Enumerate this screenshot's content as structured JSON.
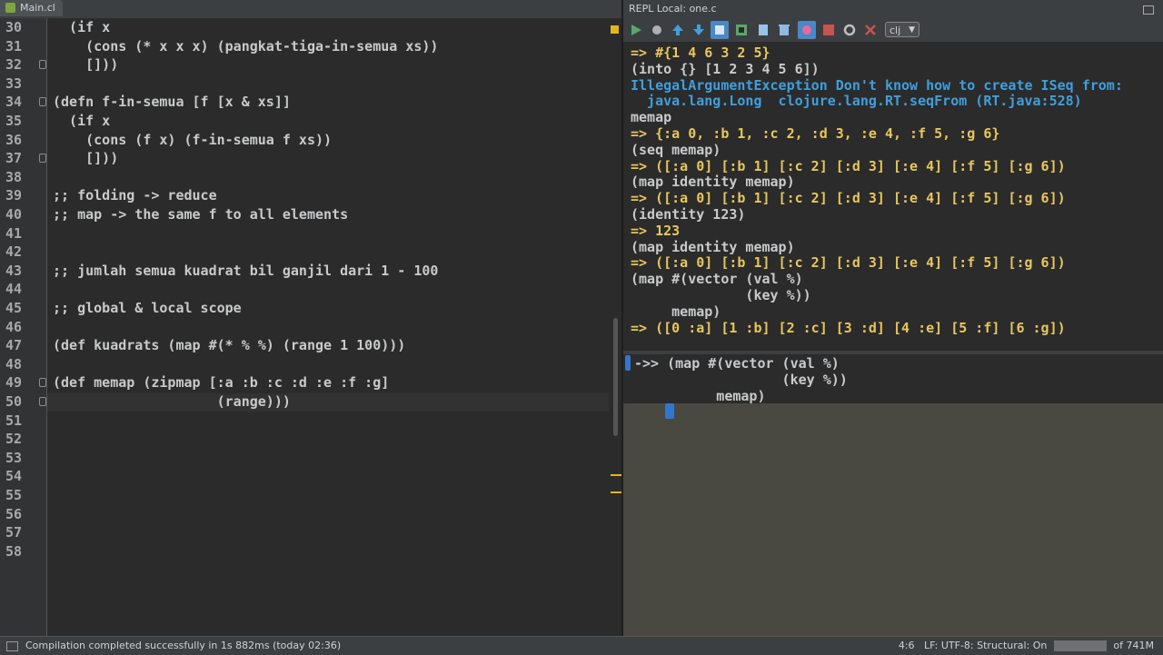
{
  "editor": {
    "tab_title": "Main.cl",
    "lines": [
      {
        "n": "30",
        "text": "  (if x"
      },
      {
        "n": "31",
        "text": "    (cons (* x x x) (pangkat-tiga-in-semua xs))"
      },
      {
        "n": "32",
        "text": "    []))"
      },
      {
        "n": "33",
        "text": ""
      },
      {
        "n": "34",
        "text": "(defn f-in-semua [f [x & xs]]"
      },
      {
        "n": "35",
        "text": "  (if x"
      },
      {
        "n": "36",
        "text": "    (cons (f x) (f-in-semua f xs))"
      },
      {
        "n": "37",
        "text": "    []))"
      },
      {
        "n": "38",
        "text": ""
      },
      {
        "n": "39",
        "text": ";; folding -> reduce"
      },
      {
        "n": "40",
        "text": ";; map -> the same f to all elements"
      },
      {
        "n": "41",
        "text": ""
      },
      {
        "n": "42",
        "text": ""
      },
      {
        "n": "43",
        "text": ";; jumlah semua kuadrat bil ganjil dari 1 - 100"
      },
      {
        "n": "44",
        "text": ""
      },
      {
        "n": "45",
        "text": ";; global & local scope"
      },
      {
        "n": "46",
        "text": ""
      },
      {
        "n": "47",
        "text": "(def kuadrats (map #(* % %) (range 1 100)))"
      },
      {
        "n": "48",
        "text": ""
      },
      {
        "n": "49",
        "text": "(def memap (zipmap [:a :b :c :d :e :f :g]"
      },
      {
        "n": "50",
        "text": "                    (range)))"
      },
      {
        "n": "51",
        "text": ""
      },
      {
        "n": "52",
        "text": ""
      },
      {
        "n": "53",
        "text": ""
      },
      {
        "n": "54",
        "text": ""
      },
      {
        "n": "55",
        "text": ""
      },
      {
        "n": "56",
        "text": ""
      },
      {
        "n": "57",
        "text": ""
      },
      {
        "n": "58",
        "text": ""
      }
    ]
  },
  "repl": {
    "title": "REPL Local: one.c",
    "lang_select": "clj",
    "toolbar_icons": [
      "run-icon",
      "stop-icon",
      "up-arrow-icon",
      "down-arrow-icon",
      "history-icon",
      "load-file-icon",
      "copy-icon",
      "clear-icon",
      "pin-icon",
      "close-red-icon",
      "refresh-icon",
      "close-x-icon"
    ],
    "output": [
      {
        "k": "res",
        "text": "=> #{1 4 6 3 2 5}"
      },
      {
        "k": "cmd",
        "text": "(into {} [1 2 3 4 5 6])"
      },
      {
        "k": "err",
        "text": "IllegalArgumentException Don't know how to create ISeq from:"
      },
      {
        "k": "err",
        "text": "  java.lang.Long  clojure.lang.RT.seqFrom (RT.java:528)"
      },
      {
        "k": "cmd",
        "text": "memap"
      },
      {
        "k": "res",
        "text": "=> {:a 0, :b 1, :c 2, :d 3, :e 4, :f 5, :g 6}"
      },
      {
        "k": "cmd",
        "text": "(seq memap)"
      },
      {
        "k": "res",
        "text": "=> ([:a 0] [:b 1] [:c 2] [:d 3] [:e 4] [:f 5] [:g 6])"
      },
      {
        "k": "cmd",
        "text": "(map identity memap)"
      },
      {
        "k": "res",
        "text": "=> ([:a 0] [:b 1] [:c 2] [:d 3] [:e 4] [:f 5] [:g 6])"
      },
      {
        "k": "cmd",
        "text": "(identity 123)"
      },
      {
        "k": "res",
        "text": "=> 123"
      },
      {
        "k": "cmd",
        "text": "(map identity memap)"
      },
      {
        "k": "res",
        "text": "=> ([:a 0] [:b 1] [:c 2] [:d 3] [:e 4] [:f 5] [:g 6])"
      },
      {
        "k": "cmd",
        "text": "(map #(vector (val %)"
      },
      {
        "k": "cmd",
        "text": "              (key %))"
      },
      {
        "k": "cmd",
        "text": "     memap)"
      },
      {
        "k": "res",
        "text": "=> ([0 :a] [1 :b] [2 :c] [3 :d] [4 :e] [5 :f] [6 :g])"
      }
    ],
    "input": [
      "->> (map #(vector (val %)",
      "                  (key %))",
      "          memap)"
    ]
  },
  "status": {
    "message": "Compilation completed successfully in 1s 882ms (today 02:36)",
    "position": "4:6",
    "line_sep": "LF",
    "encoding": "UTF-8",
    "structural": "Structural: On",
    "memory": "of 741M"
  }
}
